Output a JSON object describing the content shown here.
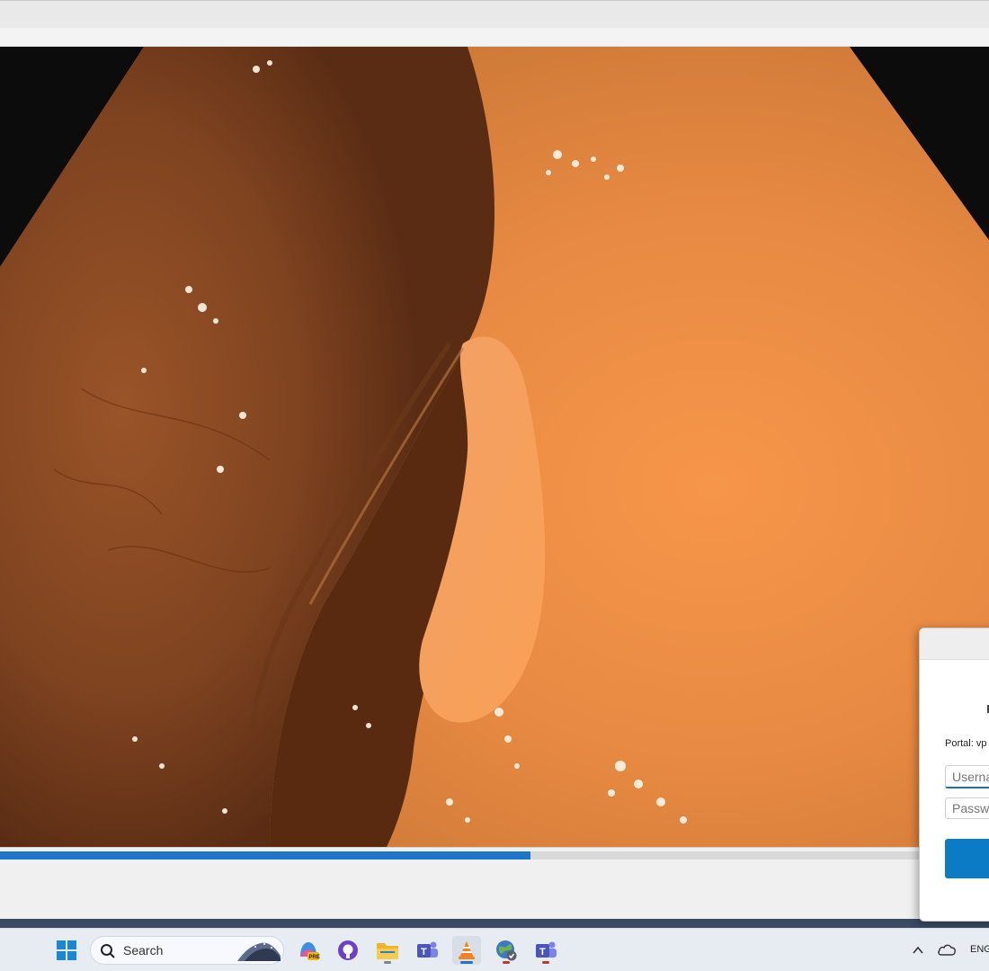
{
  "dialog": {
    "portal_label": "Portal: vp",
    "username_placeholder": "Userna",
    "password_placeholder": "Passwo"
  },
  "player": {
    "progress_fraction": 0.536
  },
  "taskbar": {
    "search_label": "Search",
    "language": "ENG",
    "apps": [
      "start-icon",
      "copilot-icon",
      "github-icon",
      "file-explorer-icon",
      "teams-icon",
      "vlc-icon",
      "vpn-globe-icon",
      "teams-icon"
    ]
  },
  "colors": {
    "accent": "#1e74c8",
    "signin_button": "#0a7bc4"
  }
}
